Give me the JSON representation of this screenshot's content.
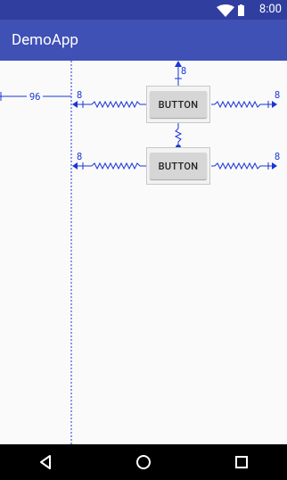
{
  "status_bar": {
    "time": "8:00",
    "icons": [
      "wifi-icon",
      "battery-icon"
    ]
  },
  "app_bar": {
    "title": "DemoApp",
    "color": "#3f51b5",
    "status_color": "#303f9f"
  },
  "layout_editor": {
    "constraint_color": "#1a35d6",
    "vertical_guideline": {
      "offset_label": "96"
    },
    "buttons": [
      {
        "label": "BUTTON",
        "margins": {
          "top": "8",
          "left": "8",
          "right": "8"
        }
      },
      {
        "label": "BUTTON",
        "margins": {
          "left": "8",
          "right": "8"
        }
      }
    ]
  },
  "nav_bar": {
    "buttons": [
      "back-icon",
      "home-icon",
      "recents-icon"
    ]
  }
}
